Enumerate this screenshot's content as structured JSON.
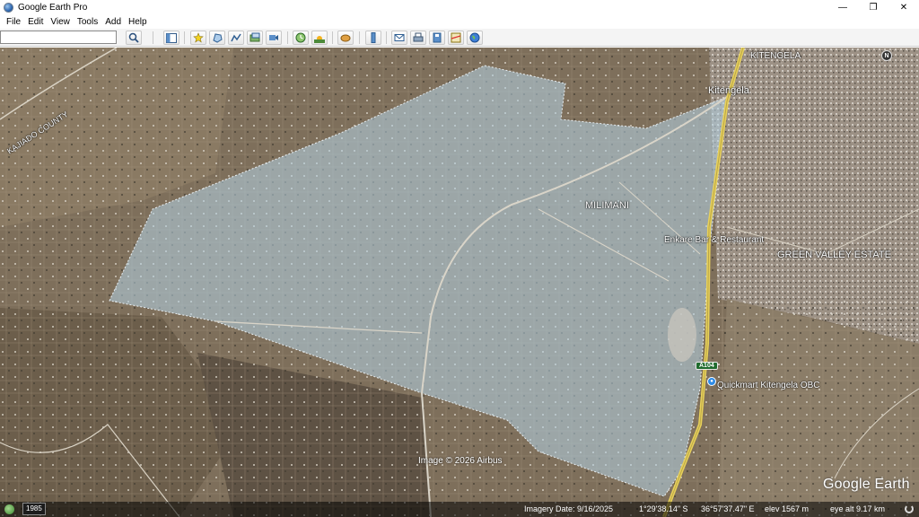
{
  "window": {
    "title": "Google Earth Pro",
    "minimize": "—",
    "maximize": "❐",
    "close": "✕"
  },
  "menu": [
    "File",
    "Edit",
    "View",
    "Tools",
    "Add",
    "Help"
  ],
  "toolbar": {
    "search_value": "",
    "tools": [
      {
        "name": "search-button",
        "icon": "magnifier"
      },
      {
        "name": "sidebar-toggle-button",
        "icon": "sidebar"
      },
      {
        "name": "add-placemark-button",
        "icon": "pushpin"
      },
      {
        "name": "add-polygon-button",
        "icon": "polygon"
      },
      {
        "name": "add-path-button",
        "icon": "path"
      },
      {
        "name": "add-image-overlay-button",
        "icon": "overlay"
      },
      {
        "name": "record-tour-button",
        "icon": "tour"
      },
      {
        "name": "historical-imagery-button",
        "icon": "clock"
      },
      {
        "name": "sunlight-button",
        "icon": "sun"
      },
      {
        "name": "switch-planet-button",
        "icon": "planet"
      },
      {
        "name": "ruler-button",
        "icon": "ruler"
      },
      {
        "name": "email-button",
        "icon": "email"
      },
      {
        "name": "print-button",
        "icon": "print"
      },
      {
        "name": "save-image-button",
        "icon": "save-image"
      },
      {
        "name": "view-in-maps-button",
        "icon": "maps"
      },
      {
        "name": "earth-button",
        "icon": "earth"
      }
    ]
  },
  "map": {
    "labels": {
      "kitengela_top": "KITENGELA",
      "kitengela": "Kitengela",
      "kajiado_county": "KAJIADO COUNTY",
      "milimani": "MILIMANI",
      "enkare": "Enkare Bar & Restaurant",
      "green_valley": "GREEN VALLEY ESTATE",
      "road_shield": "A104",
      "quickmart": "Quickmart Kitengela OBC"
    },
    "compass": "N",
    "copyright": "Image © 2026 Airbus",
    "logo": "Google Earth"
  },
  "status": {
    "year": "1985",
    "imagery_date": "Imagery Date: 9/16/2025",
    "lat": "1°29'38.14\" S",
    "lon": "36°57'37.47\" E",
    "elev": "elev  1567 m",
    "eye_alt": "eye alt   9.17 km"
  },
  "colors": {
    "polygon_fill": "#b5d3e6",
    "road": "#e8d15a",
    "terrain": "#7e6f5b"
  }
}
